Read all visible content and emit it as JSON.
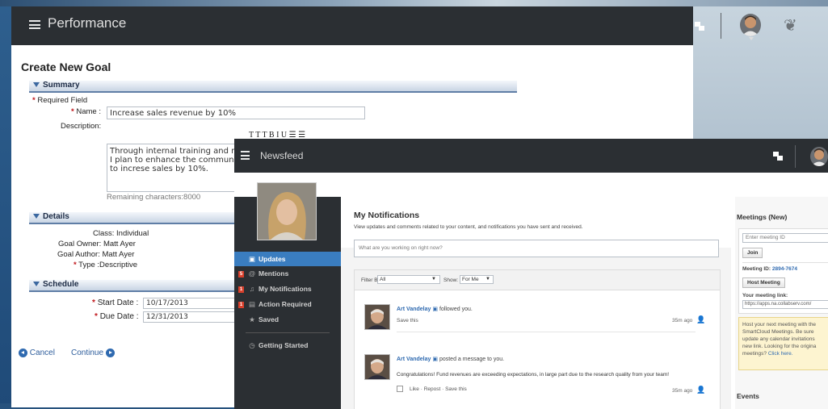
{
  "performance": {
    "title": "Performance",
    "page_title": "Create New Goal",
    "summary": {
      "header": "Summary",
      "required_field": "Required Field",
      "name_label": "Name :",
      "name_value": "Increase sales revenue by 10%",
      "description_label": "Description:",
      "toolbar": "T T T B I U ☰ ☰",
      "description_lines": [
        "Through internal training and m",
        "I plan to enhance the communi",
        "to increse sales by 10%."
      ],
      "remaining": "Remaining characters:8000"
    },
    "details": {
      "header": "Details",
      "class_label": "Class:",
      "class_value": "Individual",
      "owner_label": "Goal Owner:",
      "owner_value": "Matt Ayer",
      "author_label": "Goal Author:",
      "author_value": "Matt Ayer",
      "type_label": "Type :",
      "type_value": "Descriptive"
    },
    "schedule": {
      "header": "Schedule",
      "start_label": "Start Date :",
      "start_value": "10/17/2013",
      "due_label": "Due Date :",
      "due_value": "12/31/2013"
    },
    "cancel": "Cancel",
    "continue": "Continue"
  },
  "newsfeed": {
    "title": "Newsfeed",
    "sidebar": [
      {
        "label": "Updates",
        "icon": "updates-icon"
      },
      {
        "label": "Mentions",
        "badge": "5",
        "icon": "at-icon"
      },
      {
        "label": "My Notifications",
        "badge": "1",
        "icon": "bell-icon"
      },
      {
        "label": "Action Required",
        "badge": "1",
        "icon": "clipboard-icon"
      },
      {
        "label": "Saved",
        "icon": "star-icon"
      },
      {
        "label": "Getting Started",
        "icon": "clock-icon"
      }
    ],
    "heading": "My Notifications",
    "subheading": "View updates and comments related to your content, and notifications you have sent and received.",
    "status_placeholder": "What are you working on right now?",
    "filter_by_label": "Filter By:",
    "filter_by_value": "All",
    "show_label": "Show:",
    "show_value": "For Me",
    "entries": [
      {
        "author": "Art Vandelay",
        "action": "followed you.",
        "links": "Save this",
        "time": "35m ago"
      },
      {
        "author": "Art Vandelay",
        "action": "posted a message to you.",
        "message": "Congratulations! Fund revenues are exceeding expectations, in large part due to the research quality from your team!",
        "links": "Like · Repost · Save this",
        "time": "35m ago"
      }
    ],
    "meetings": {
      "title": "Meetings (New)",
      "meeting_id_placeholder": "Enter meeting ID",
      "join": "Join",
      "meeting_id_label": "Meeting ID:",
      "meeting_id_value": "2894-7674",
      "host": "Host Meeting",
      "link_label": "Your meeting link:",
      "link_value": "https://apps.na.collabserv.com/",
      "notice_lines": [
        "Host your next meeting with the",
        "SmartCloud Meetings. Be sure",
        "update any calendar invitations",
        "new link. Looking for the origina",
        "meetings?"
      ],
      "click_here": "Click here."
    },
    "events_title": "Events"
  }
}
